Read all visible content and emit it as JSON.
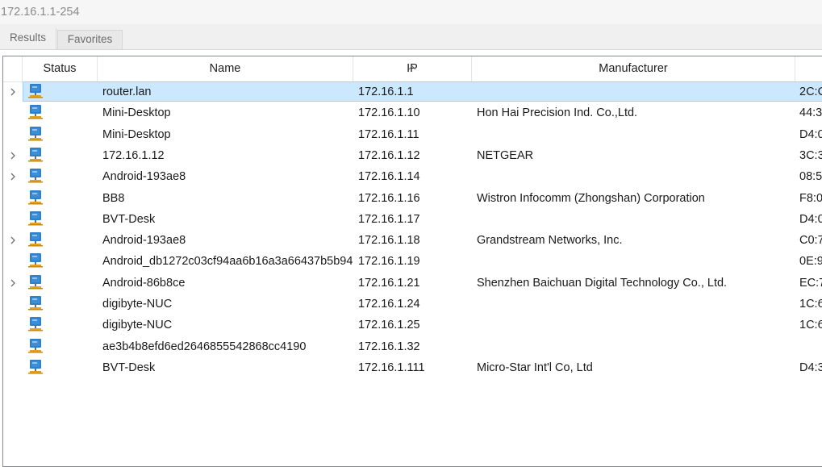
{
  "scan_range": {
    "value": "172.16.1.1-254"
  },
  "tabs": [
    {
      "label": "Results",
      "active": true
    },
    {
      "label": "Favorites",
      "active": false
    }
  ],
  "columns": {
    "status": "Status",
    "name": "Name",
    "ip": "IP",
    "manufacturer": "Manufacturer"
  },
  "sort": {
    "column": "IP",
    "direction": "ascending"
  },
  "colors": {
    "selection_fill": "#cce8ff",
    "selection_border": "#99d1ff",
    "icon_monitor": "#3c8fd6",
    "icon_base": "#e3a21a"
  },
  "rows": [
    {
      "expandable": true,
      "selected": true,
      "name": "router.lan",
      "ip": "172.16.1.1",
      "manufacturer": "",
      "mac": "2C:C"
    },
    {
      "expandable": false,
      "selected": false,
      "name": "Mini-Desktop",
      "ip": "172.16.1.10",
      "manufacturer": "Hon Hai Precision Ind. Co.,Ltd.",
      "mac": "44:3"
    },
    {
      "expandable": false,
      "selected": false,
      "name": "Mini-Desktop",
      "ip": "172.16.1.11",
      "manufacturer": "",
      "mac": "D4:0"
    },
    {
      "expandable": true,
      "selected": false,
      "name": "172.16.1.12",
      "ip": "172.16.1.12",
      "manufacturer": "NETGEAR",
      "mac": "3C:3"
    },
    {
      "expandable": true,
      "selected": false,
      "name": "Android-193ae8",
      "ip": "172.16.1.14",
      "manufacturer": "",
      "mac": "08:5"
    },
    {
      "expandable": false,
      "selected": false,
      "name": "BB8",
      "ip": "172.16.1.16",
      "manufacturer": "Wistron Infocomm (Zhongshan) Corporation",
      "mac": "F8:0"
    },
    {
      "expandable": false,
      "selected": false,
      "name": "BVT-Desk",
      "ip": "172.16.1.17",
      "manufacturer": "",
      "mac": "D4:0"
    },
    {
      "expandable": true,
      "selected": false,
      "name": "Android-193ae8",
      "ip": "172.16.1.18",
      "manufacturer": "Grandstream Networks, Inc.",
      "mac": "C0:7"
    },
    {
      "expandable": false,
      "selected": false,
      "name": "Android_db1272c03cf94aa6b16a3a66437b5b94",
      "ip": "172.16.1.19",
      "manufacturer": "",
      "mac": "0E:9"
    },
    {
      "expandable": true,
      "selected": false,
      "name": "Android-86b8ce",
      "ip": "172.16.1.21",
      "manufacturer": "Shenzhen Baichuan Digital Technology Co., Ltd.",
      "mac": "EC:7"
    },
    {
      "expandable": false,
      "selected": false,
      "name": "digibyte-NUC",
      "ip": "172.16.1.24",
      "manufacturer": "",
      "mac": "1C:6"
    },
    {
      "expandable": false,
      "selected": false,
      "name": "digibyte-NUC",
      "ip": "172.16.1.25",
      "manufacturer": "",
      "mac": "1C:6"
    },
    {
      "expandable": false,
      "selected": false,
      "name": "ae3b4b8efd6ed2646855542868cc4190",
      "ip": "172.16.1.32",
      "manufacturer": "",
      "mac": ""
    },
    {
      "expandable": false,
      "selected": false,
      "name": "BVT-Desk",
      "ip": "172.16.1.111",
      "manufacturer": "Micro-Star Int'l Co, Ltd",
      "mac": "D4:3"
    }
  ]
}
